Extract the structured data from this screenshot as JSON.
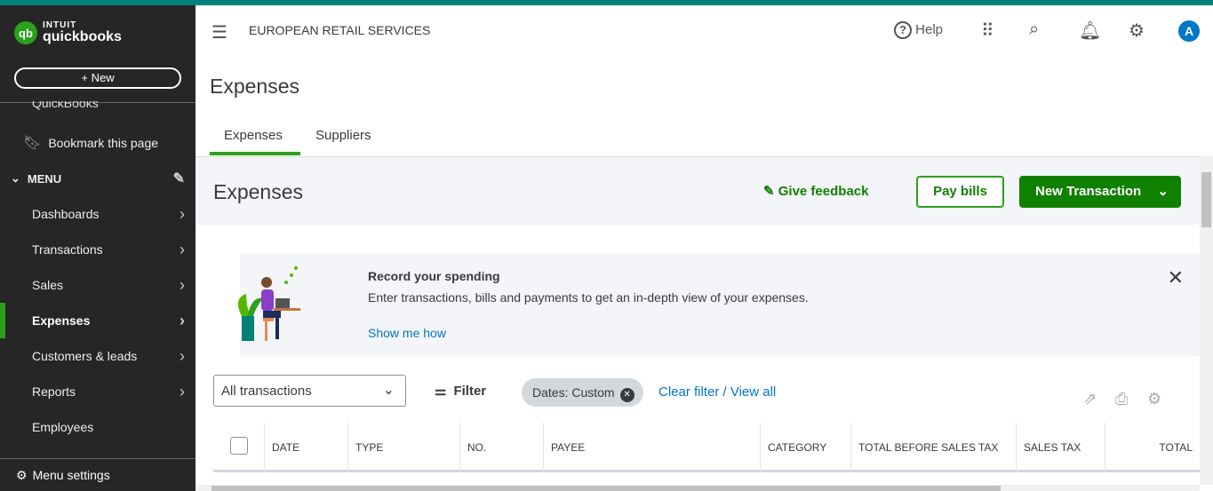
{
  "brand": {
    "intuit": "INTUIT",
    "name": "quickbooks",
    "logo": "qb"
  },
  "sidebar": {
    "new_label": "+   New",
    "partial": "QuickBooks",
    "bookmark": "Bookmark this page",
    "menu": "MENU",
    "items": [
      {
        "label": "Dashboards"
      },
      {
        "label": "Transactions"
      },
      {
        "label": "Sales"
      },
      {
        "label": "Expenses",
        "active": true
      },
      {
        "label": "Customers & leads"
      },
      {
        "label": "Reports"
      },
      {
        "label": "Employees"
      }
    ],
    "menu_settings": "Menu settings"
  },
  "header": {
    "company": "EUROPEAN RETAIL SERVICES",
    "help": "Help",
    "avatar": "A"
  },
  "page": {
    "title": "Expenses",
    "tabs": [
      "Expenses",
      "Suppliers"
    ],
    "section_title": "Expenses",
    "give_feedback": "Give feedback",
    "pay_bills": "Pay bills",
    "new_transaction": "New Transaction"
  },
  "banner": {
    "title": "Record your spending",
    "text": "Enter transactions, bills and payments to get an in-depth view of your expenses.",
    "link": "Show me how"
  },
  "filters": {
    "select": "All transactions",
    "filter": "Filter",
    "chip": "Dates: Custom",
    "clear": "Clear filter / View all"
  },
  "table": {
    "columns": [
      "DATE",
      "TYPE",
      "NO.",
      "PAYEE",
      "CATEGORY",
      "TOTAL BEFORE SALES TAX",
      "SALES TAX",
      "TOTAL"
    ]
  }
}
